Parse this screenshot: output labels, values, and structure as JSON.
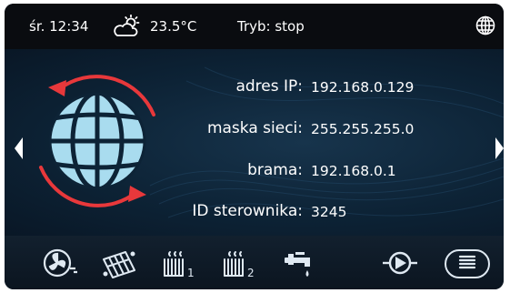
{
  "topbar": {
    "time": "śr. 12:34",
    "temperature": "23.5°C",
    "mode": "Tryb: stop",
    "weather_icon": "sun-cloud-icon",
    "network_icon": "globe-icon"
  },
  "network": {
    "ip_label": "adres IP:",
    "ip_value": "192.168.0.129",
    "mask_label": "maska sieci:",
    "mask_value": "255.255.255.0",
    "gateway_label": "brama:",
    "gateway_value": "192.168.0.1",
    "controller_id_label": "ID sterownika:",
    "controller_id_value": "3245"
  },
  "navigation": {
    "prev_icon": "triangle-left-icon",
    "next_icon": "triangle-right-icon",
    "items": [
      {
        "icon": "fan-icon"
      },
      {
        "icon": "solar-collector-icon"
      },
      {
        "icon": "heater-1-icon",
        "label": "1"
      },
      {
        "icon": "heater-2-icon",
        "label": "2"
      },
      {
        "icon": "tap-icon"
      },
      {
        "icon": "pump-icon"
      },
      {
        "icon": "menu-icon"
      }
    ]
  },
  "colors": {
    "accent_red": "#e8383b",
    "globe_blue": "#a9dcef",
    "topbar_bg": "#0a0c10",
    "screen_bg": "#0d2336"
  }
}
